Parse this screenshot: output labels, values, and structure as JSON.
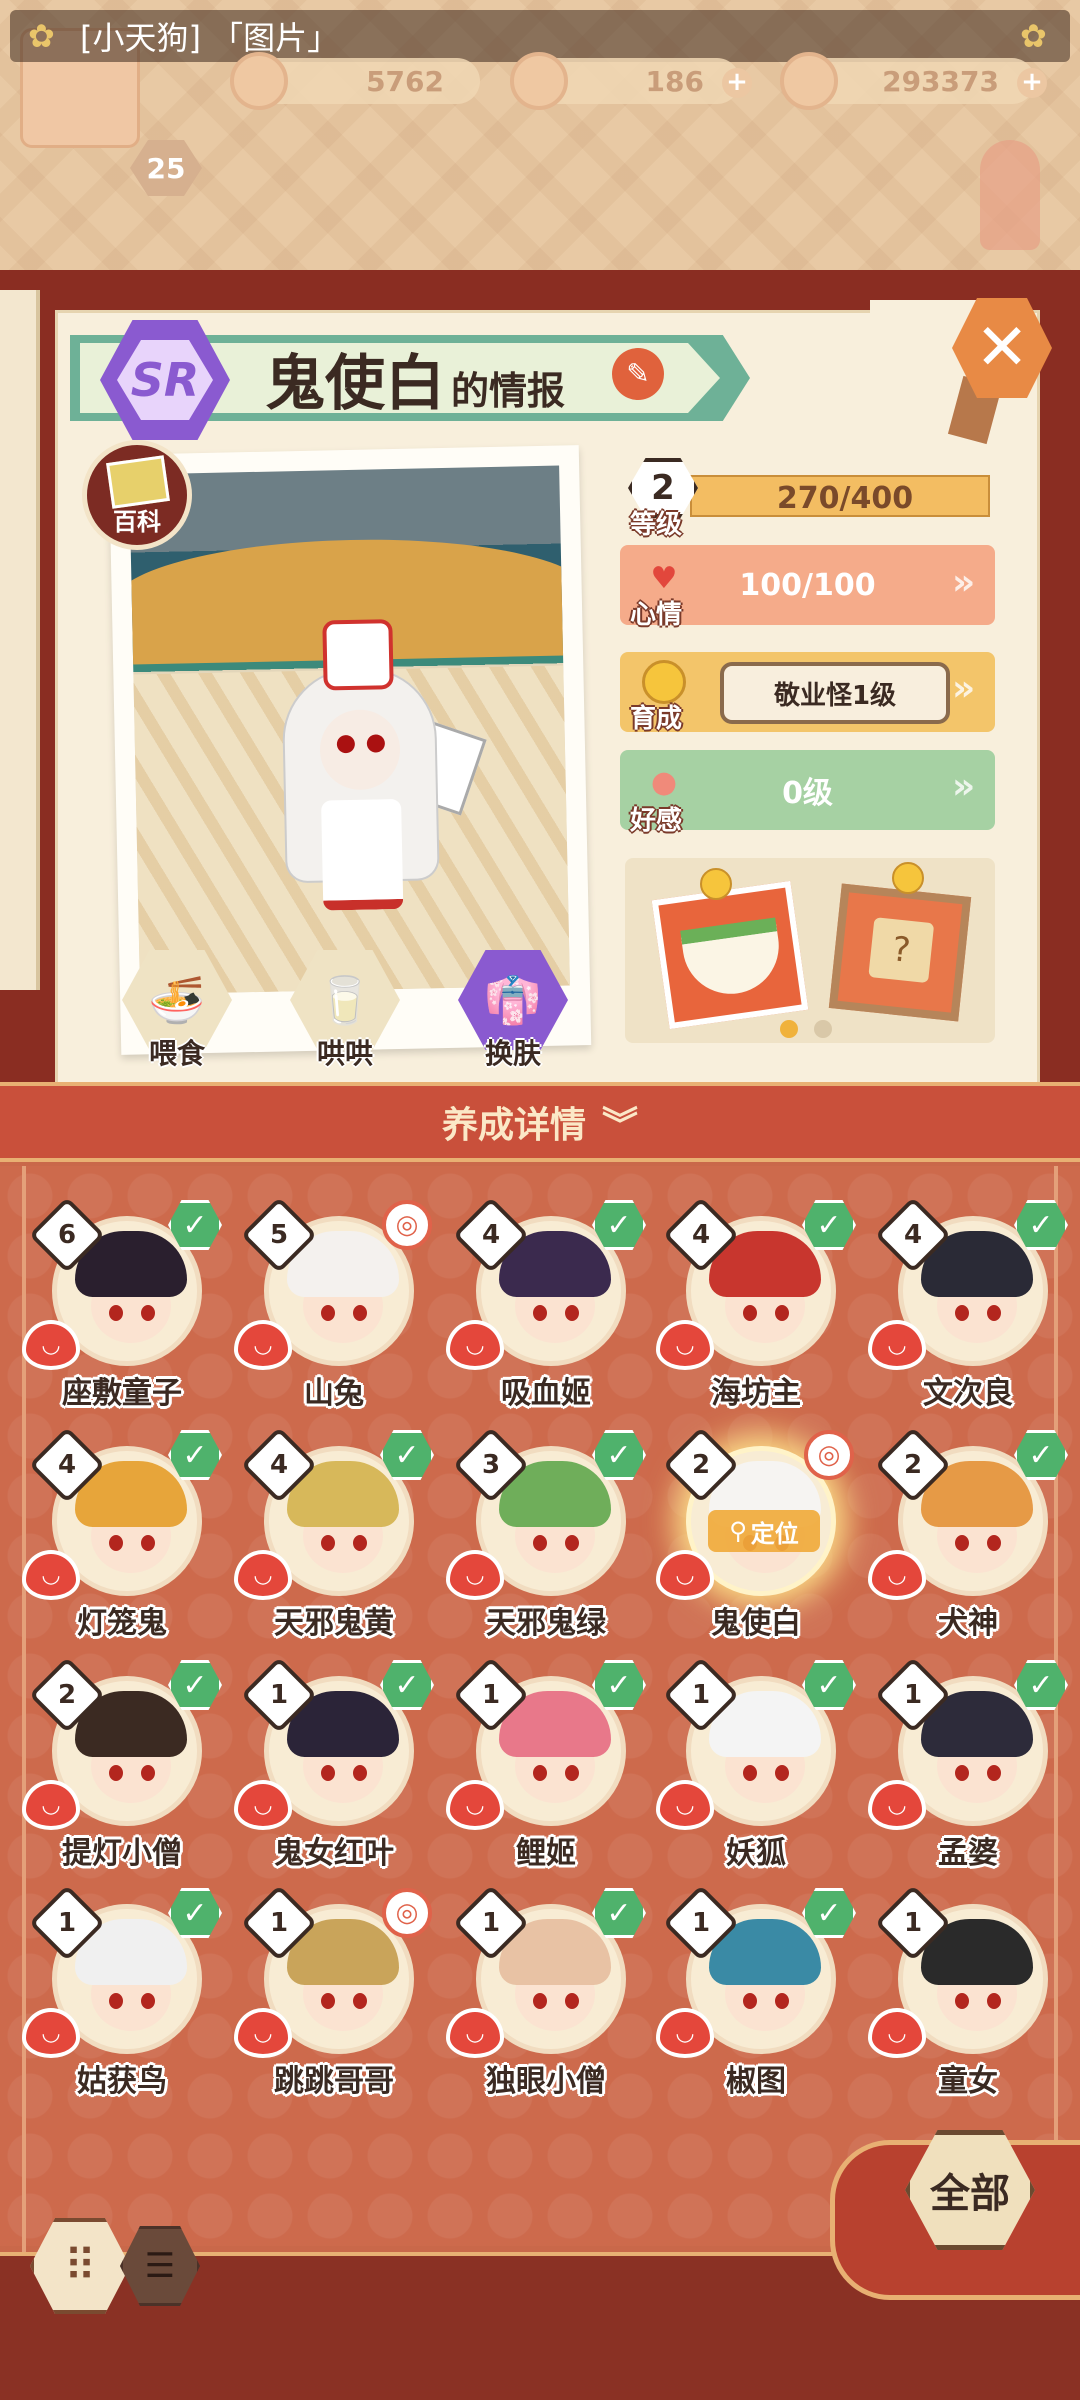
{
  "window": {
    "title": "[小天狗] 「图片」"
  },
  "resources": [
    {
      "value": "5762",
      "icon": "flower-coin-icon"
    },
    {
      "value": "186",
      "icon": "flame-icon"
    },
    {
      "value": "293373",
      "icon": "gold-coin-icon"
    }
  ],
  "player": {
    "level": "25"
  },
  "info": {
    "rarity": "SR",
    "name": "鬼使白",
    "suffix": "的情报",
    "wiki_label": "百科",
    "level": "2",
    "level_label": "等级",
    "exp": "270/400",
    "mood_label": "心情",
    "mood": "100/100",
    "growth_label": "育成",
    "growth_value": "敬业怪1级",
    "affection_label": "好感",
    "affection": "0级",
    "actions": [
      {
        "label": "喂食",
        "icon": "noodle-bowl-icon"
      },
      {
        "label": "哄哄",
        "icon": "milk-carton-icon"
      },
      {
        "label": "换肤",
        "icon": "robe-icon"
      }
    ],
    "gifts": [
      {
        "icon": "food-bowl-icon"
      },
      {
        "icon": "mystery-frame-icon"
      }
    ]
  },
  "section": {
    "title": "养成详情"
  },
  "yokai": [
    {
      "name": "座敷童子",
      "level": "6",
      "status": "check",
      "hair": "#2a1f2e"
    },
    {
      "name": "山兔",
      "level": "5",
      "status": "circle",
      "hair": "#f4f1ee"
    },
    {
      "name": "吸血姬",
      "level": "4",
      "status": "check",
      "hair": "#3b2a4e"
    },
    {
      "name": "海坊主",
      "level": "4",
      "status": "check",
      "hair": "#c8362e"
    },
    {
      "name": "文次良",
      "level": "4",
      "status": "check",
      "hair": "#2a2a36"
    },
    {
      "name": "灯笼鬼",
      "level": "4",
      "status": "check",
      "hair": "#e7a53a"
    },
    {
      "name": "天邪鬼黄",
      "level": "4",
      "status": "check",
      "hair": "#d7b85a"
    },
    {
      "name": "天邪鬼绿",
      "level": "3",
      "status": "check",
      "hair": "#6fae5a"
    },
    {
      "name": "鬼使白",
      "level": "2",
      "status": "circle",
      "hair": "#f6f4f2",
      "selected": true,
      "locate": "定位"
    },
    {
      "name": "犬神",
      "level": "2",
      "status": "check",
      "hair": "#e69a46"
    },
    {
      "name": "提灯小僧",
      "level": "2",
      "status": "check",
      "hair": "#3b2a22"
    },
    {
      "name": "鬼女红叶",
      "level": "1",
      "status": "check",
      "hair": "#2b2438"
    },
    {
      "name": "鲤姬",
      "level": "1",
      "status": "check",
      "hair": "#e8788a"
    },
    {
      "name": "妖狐",
      "level": "1",
      "status": "check",
      "hair": "#f4f4f4"
    },
    {
      "name": "孟婆",
      "level": "1",
      "status": "check",
      "hair": "#2d2b3a"
    },
    {
      "name": "姑获鸟",
      "level": "1",
      "status": "check",
      "hair": "#f0f0f0"
    },
    {
      "name": "跳跳哥哥",
      "level": "1",
      "status": "circle",
      "hair": "#c9a45a"
    },
    {
      "name": "独眼小僧",
      "level": "1",
      "status": "check",
      "hair": "#e8c2a4"
    },
    {
      "name": "椒图",
      "level": "1",
      "status": "check",
      "hair": "#3a8aa5"
    },
    {
      "name": "童女",
      "level": "1",
      "status": "none",
      "hair": "#2a2a2a"
    }
  ],
  "bottom": {
    "all_label": "全部"
  },
  "colors": {
    "accent_green": "#4fb26c",
    "accent_red": "#c9503b",
    "panel_bg": "#f8efdc"
  }
}
